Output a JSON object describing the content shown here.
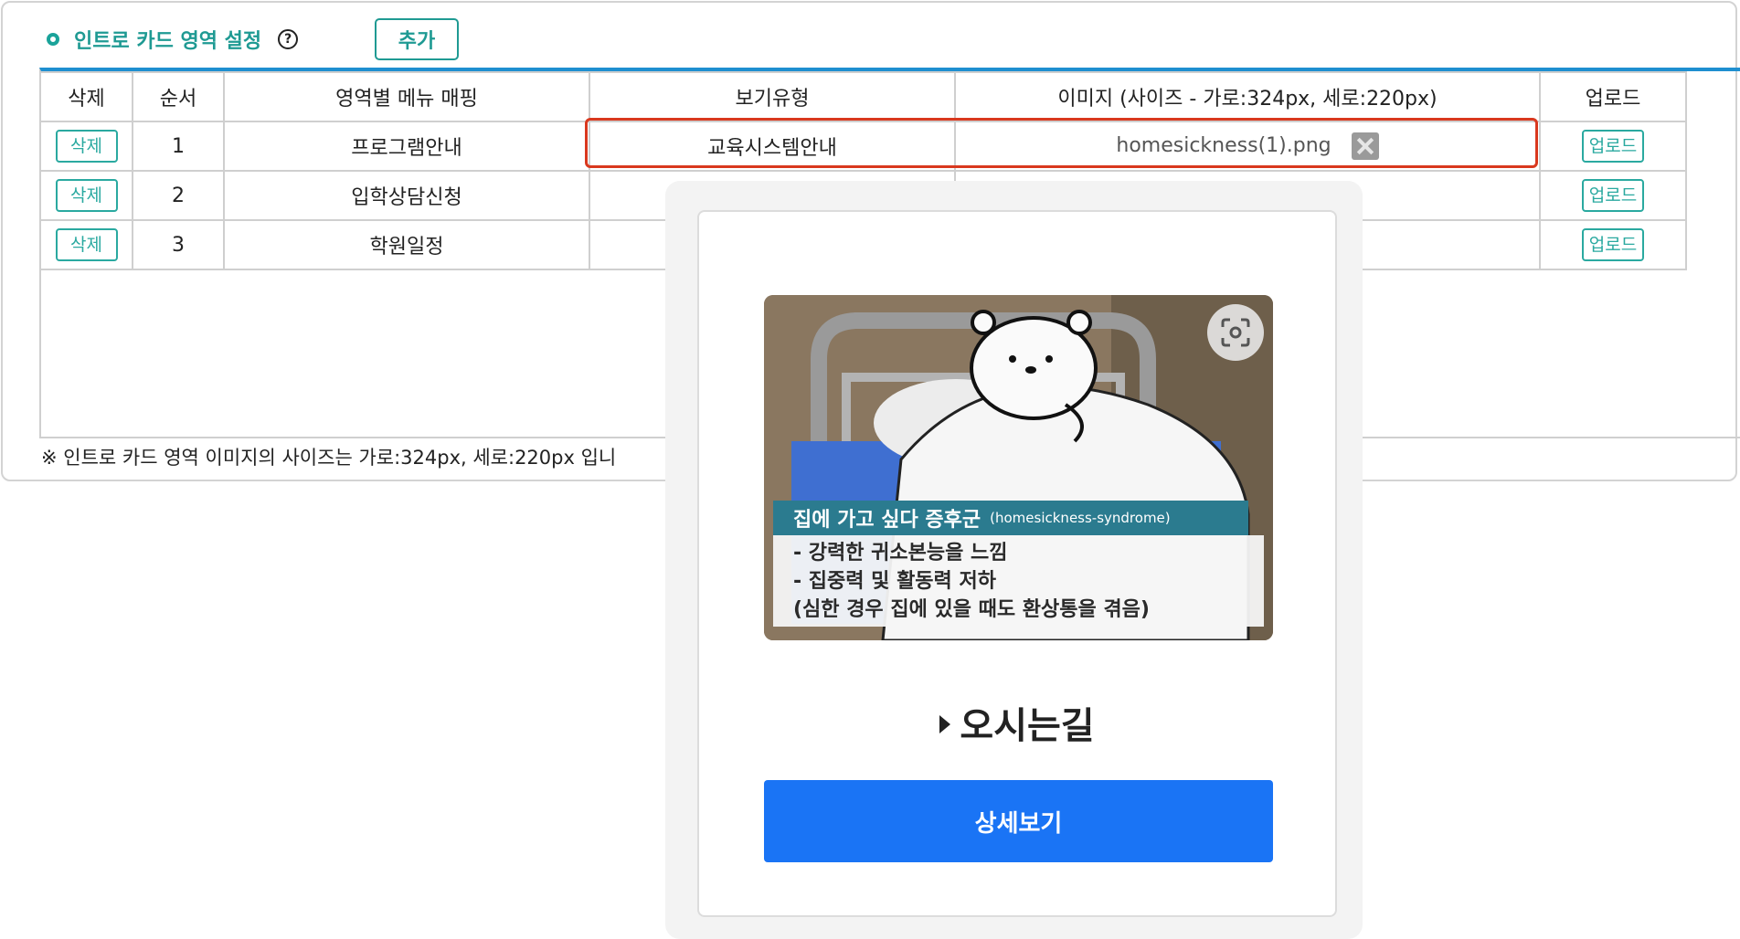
{
  "section": {
    "title": "인트로 카드 영역 설정",
    "help_symbol": "?",
    "add_label": "추가"
  },
  "table": {
    "headers": [
      "삭제",
      "순서",
      "영역별 메뉴 매핑",
      "보기유형",
      "이미지 (사이즈 - 가로:324px, 세로:220px)",
      "업로드"
    ],
    "rows": [
      {
        "delete_label": "삭제",
        "order": "1",
        "menu": "프로그램안내",
        "view_type": "교육시스템안내",
        "image": "homesickness(1).png",
        "upload_label": "업로드"
      },
      {
        "delete_label": "삭제",
        "order": "2",
        "menu": "입학상담신청",
        "view_type": "",
        "image": "",
        "upload_label": "업로드"
      },
      {
        "delete_label": "삭제",
        "order": "3",
        "menu": "학원일정",
        "view_type": "",
        "image": "",
        "upload_label": "업로드"
      }
    ]
  },
  "note": "※ 인트로 카드 영역 이미지의 사이즈는 가로:324px, 세로:220px 입니",
  "popup": {
    "caption_title": "집에 가고 싶다 증후군",
    "caption_sub": "(homesickness-syndrome)",
    "caption_lines": [
      "- 강력한 귀소본능을 느낌",
      "- 집중력 및 활동력 저하",
      "(심한 경우 집에 있을 때도 환상통을 겪음)"
    ],
    "title": "오시는길",
    "detail_label": "상세보기"
  },
  "colors": {
    "accent": "#1f9a93",
    "table_top_border": "#1e8fd0",
    "highlight": "#d9381e",
    "primary_button": "#1a74f5"
  }
}
